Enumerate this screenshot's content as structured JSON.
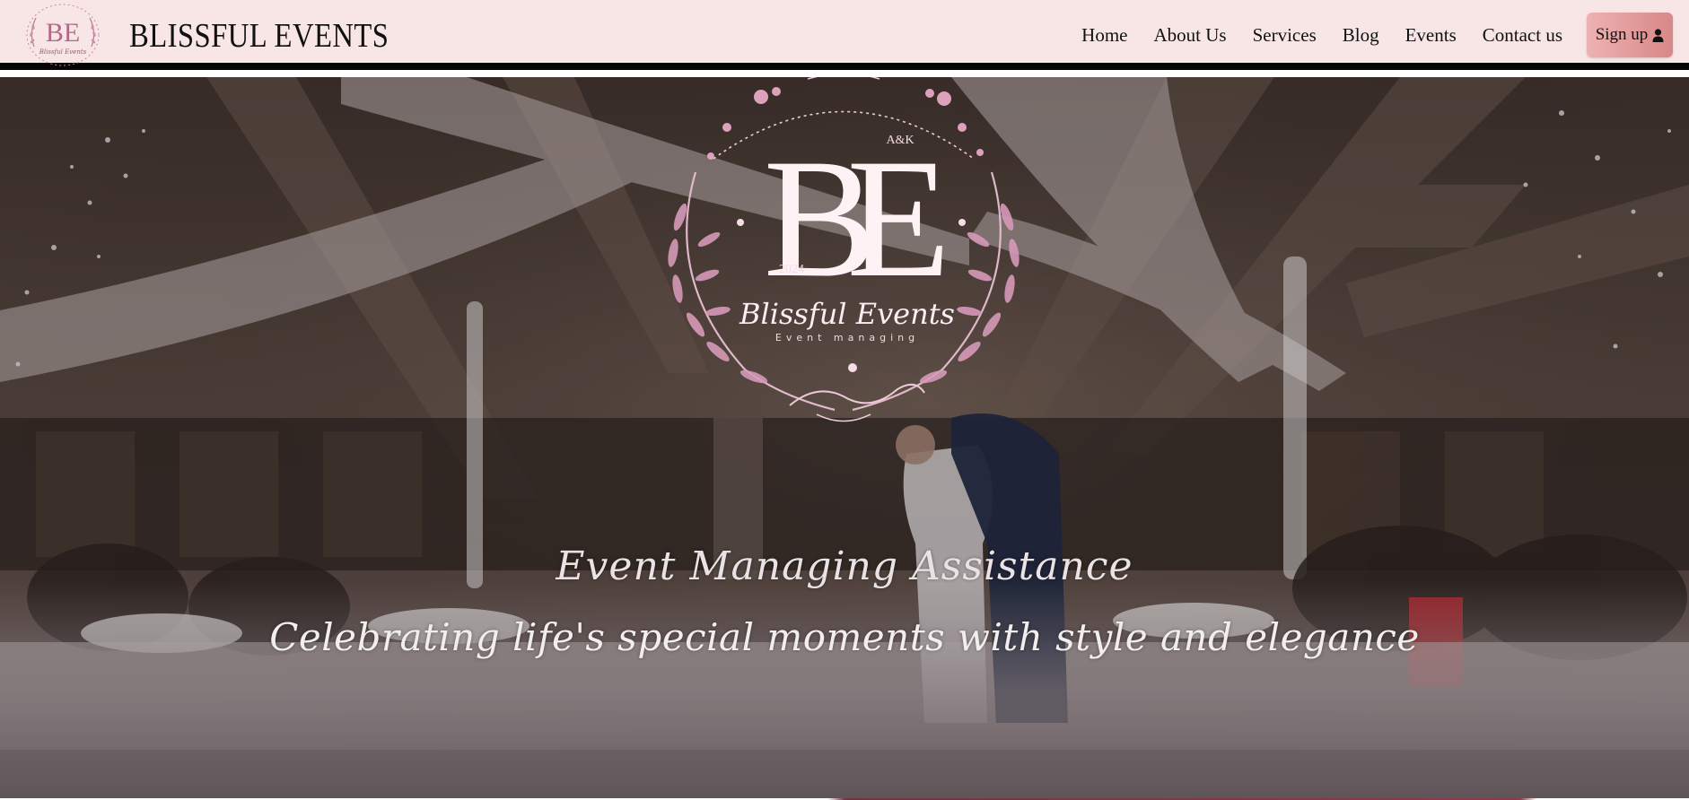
{
  "navbar": {
    "logo_icon": "blissful-events-monogram-logo",
    "logo_monogram": "BE",
    "logo_caption": "Blissful Events",
    "brand_name": "BLISSFUL EVENTS",
    "links": [
      {
        "label": "Home"
      },
      {
        "label": "About Us"
      },
      {
        "label": "Services"
      },
      {
        "label": "Blog"
      },
      {
        "label": "Events"
      },
      {
        "label": "Contact us"
      }
    ],
    "signup_label": "Sign up",
    "signup_icon": "user-icon"
  },
  "hero": {
    "logo": {
      "monogram": "BE",
      "initials": "A&K",
      "year": "2024",
      "script_name": "Blissful Events",
      "tagline": "Event managing"
    },
    "title": "Event Managing Assistance",
    "subtitle": "Celebrating life's special moments with style and elegance"
  },
  "colors": {
    "navbar_bg": "#f7e6e5",
    "accent_pink": "#d98787",
    "logo_pink": "#c98aa5"
  }
}
